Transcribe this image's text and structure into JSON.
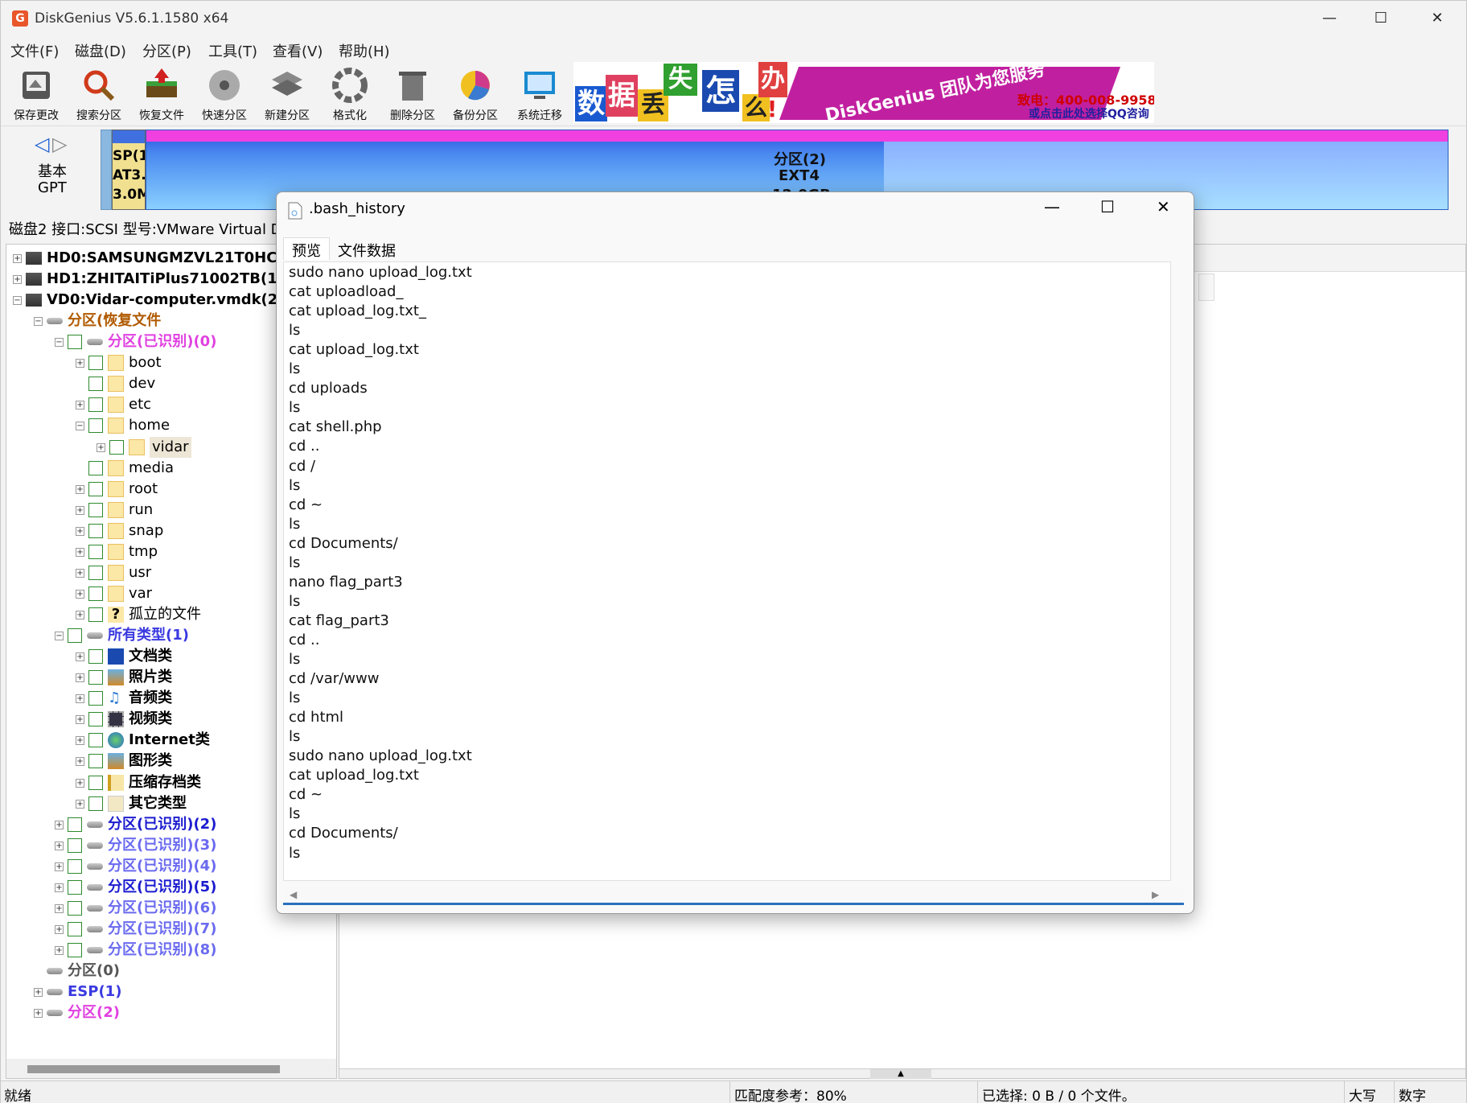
{
  "app": {
    "title": "DiskGenius V5.6.1.1580 x64",
    "logo": "G"
  },
  "window_controls": {
    "minimize": "—",
    "maximize": "☐",
    "close": "✕"
  },
  "menu": [
    "文件(F)",
    "磁盘(D)",
    "分区(P)",
    "工具(T)",
    "查看(V)",
    "帮助(H)"
  ],
  "toolbar": [
    "保存更改",
    "搜索分区",
    "恢复文件",
    "快速分区",
    "新建分区",
    "格式化",
    "删除分区",
    "备份分区",
    "系统迁移"
  ],
  "banner": {
    "chars": [
      "数",
      "据",
      "丢",
      "失",
      "怎",
      "么",
      "办",
      "!"
    ],
    "brand": "DiskGenius 团队为您服务",
    "phone": "致电：400-008-9958",
    "qq": "或点击此处选择QQ咨询"
  },
  "diskmap": {
    "nav_type": "基本",
    "nav_scheme": "GPT",
    "seg1_l1": "SP(1",
    "seg1_l2": "AT3.",
    "seg1_l3": "3.0M",
    "main_name": "分区(2)",
    "main_fs": "EXT4",
    "main_size": "12.0GB"
  },
  "diskinfo": "磁盘2 接口:SCSI  型号:VMware Virtual D",
  "tree": [
    {
      "label": "HD0:SAMSUNGMZVL21T0HCL",
      "level": 0,
      "exp": "+",
      "icon": "disk",
      "bold": true,
      "color": "#000"
    },
    {
      "label": "HD1:ZHITAITiPlus71002TB(190",
      "level": 0,
      "exp": "+",
      "icon": "disk",
      "bold": true,
      "color": "#000"
    },
    {
      "label": "VD0:Vidar-computer.vmdk(20",
      "level": 0,
      "exp": "-",
      "icon": "disk",
      "bold": true,
      "color": "#000"
    },
    {
      "label": "分区(恢复文件",
      "level": 1,
      "exp": "-",
      "icon": "part",
      "bold": true,
      "color": "#b05a00"
    },
    {
      "label": "分区(已识别)(0)",
      "level": 2,
      "exp": "-",
      "icon": "part",
      "cb": true,
      "bold": true,
      "color": "#e040e0"
    },
    {
      "label": "boot",
      "level": 3,
      "exp": "+",
      "icon": "folder",
      "cb": true,
      "color": "#000"
    },
    {
      "label": "dev",
      "level": 3,
      "exp": "",
      "icon": "folder",
      "cb": true,
      "color": "#000"
    },
    {
      "label": "etc",
      "level": 3,
      "exp": "+",
      "icon": "folder",
      "cb": true,
      "color": "#000"
    },
    {
      "label": "home",
      "level": 3,
      "exp": "-",
      "icon": "folder",
      "cb": true,
      "color": "#000"
    },
    {
      "label": "vidar",
      "level": 4,
      "exp": "+",
      "icon": "folder",
      "cb": true,
      "color": "#000",
      "sel": true
    },
    {
      "label": "media",
      "level": 3,
      "exp": "",
      "icon": "folder",
      "cb": true,
      "color": "#000"
    },
    {
      "label": "root",
      "level": 3,
      "exp": "+",
      "icon": "folder",
      "cb": true,
      "color": "#000"
    },
    {
      "label": "run",
      "level": 3,
      "exp": "+",
      "icon": "folder",
      "cb": true,
      "color": "#000"
    },
    {
      "label": "snap",
      "level": 3,
      "exp": "+",
      "icon": "folder",
      "cb": true,
      "color": "#000"
    },
    {
      "label": "tmp",
      "level": 3,
      "exp": "+",
      "icon": "folder",
      "cb": true,
      "color": "#000"
    },
    {
      "label": "usr",
      "level": 3,
      "exp": "+",
      "icon": "folder",
      "cb": true,
      "color": "#000"
    },
    {
      "label": "var",
      "level": 3,
      "exp": "+",
      "icon": "folder",
      "cb": true,
      "color": "#000"
    },
    {
      "label": "孤立的文件",
      "level": 3,
      "exp": "+",
      "icon": "unknown",
      "cb": true,
      "color": "#000"
    },
    {
      "label": "所有类型(1)",
      "level": 2,
      "exp": "-",
      "icon": "part",
      "cb": true,
      "bold": true,
      "color": "#3a3ae0"
    },
    {
      "label": "文档类",
      "level": 3,
      "exp": "+",
      "icon": "word",
      "cb": true,
      "bold": true,
      "color": "#000"
    },
    {
      "label": "照片类",
      "level": 3,
      "exp": "+",
      "icon": "photo",
      "cb": true,
      "bold": true,
      "color": "#000"
    },
    {
      "label": "音频类",
      "level": 3,
      "exp": "+",
      "icon": "audio",
      "cb": true,
      "bold": true,
      "color": "#000"
    },
    {
      "label": "视频类",
      "level": 3,
      "exp": "+",
      "icon": "video",
      "cb": true,
      "bold": true,
      "color": "#000"
    },
    {
      "label": "Internet类",
      "level": 3,
      "exp": "+",
      "icon": "globe",
      "cb": true,
      "bold": true,
      "color": "#000"
    },
    {
      "label": "图形类",
      "level": 3,
      "exp": "+",
      "icon": "photo",
      "cb": true,
      "bold": true,
      "color": "#000"
    },
    {
      "label": "压缩存档类",
      "level": 3,
      "exp": "+",
      "icon": "zip",
      "cb": true,
      "bold": true,
      "color": "#000"
    },
    {
      "label": "其它类型",
      "level": 3,
      "exp": "+",
      "icon": "other",
      "cb": true,
      "bold": true,
      "color": "#000"
    },
    {
      "label": "分区(已识别)(2)",
      "level": 2,
      "exp": "+",
      "icon": "part",
      "cb": true,
      "bold": true,
      "color": "#1c1cd0"
    },
    {
      "label": "分区(已识别)(3)",
      "level": 2,
      "exp": "+",
      "icon": "part",
      "cb": true,
      "bold": true,
      "color": "#6a6af0"
    },
    {
      "label": "分区(已识别)(4)",
      "level": 2,
      "exp": "+",
      "icon": "part",
      "cb": true,
      "bold": true,
      "color": "#6a6af0"
    },
    {
      "label": "分区(已识别)(5)",
      "level": 2,
      "exp": "+",
      "icon": "part",
      "cb": true,
      "bold": true,
      "color": "#1c1cd0"
    },
    {
      "label": "分区(已识别)(6)",
      "level": 2,
      "exp": "+",
      "icon": "part",
      "cb": true,
      "bold": true,
      "color": "#6a6af0"
    },
    {
      "label": "分区(已识别)(7)",
      "level": 2,
      "exp": "+",
      "icon": "part",
      "cb": true,
      "bold": true,
      "color": "#6a6af0"
    },
    {
      "label": "分区(已识别)(8)",
      "level": 2,
      "exp": "+",
      "icon": "part",
      "cb": true,
      "bold": true,
      "color": "#6a6af0"
    },
    {
      "label": "分区(0)",
      "level": 1,
      "exp": "",
      "icon": "part",
      "bold": true,
      "color": "#555"
    },
    {
      "label": "ESP(1)",
      "level": 1,
      "exp": "+",
      "icon": "part",
      "bold": true,
      "color": "#3a3ae0"
    },
    {
      "label": "分区(2)",
      "level": 1,
      "exp": "+",
      "icon": "part",
      "bold": true,
      "color": "#e040e0"
    }
  ],
  "dialog": {
    "title": ".bash_history",
    "tabs": [
      "预览",
      "文件数据"
    ],
    "lines": [
      "sudo nano upload_log.txt",
      "cat uploadload_",
      "cat upload_log.txt_",
      "ls",
      "cat upload_log.txt",
      "ls",
      "cd uploads",
      "ls",
      "cat shell.php",
      "cd ..",
      "cd /",
      "ls",
      "cd ~",
      "ls",
      "cd Documents/",
      "ls",
      "nano flag_part3",
      "ls",
      "cat flag_part3",
      "cd ..",
      "ls",
      "cd /var/www",
      "ls",
      "cd html",
      "ls",
      "sudo nano upload_log.txt",
      "cat upload_log.txt",
      "cd ~",
      "ls",
      "cd Documents/",
      "ls"
    ]
  },
  "status": {
    "ready": "就绪",
    "match": "匹配度参考：80%",
    "selected": "已选择: 0 B / 0 个文件。",
    "caps": "大写",
    "num": "数字"
  }
}
